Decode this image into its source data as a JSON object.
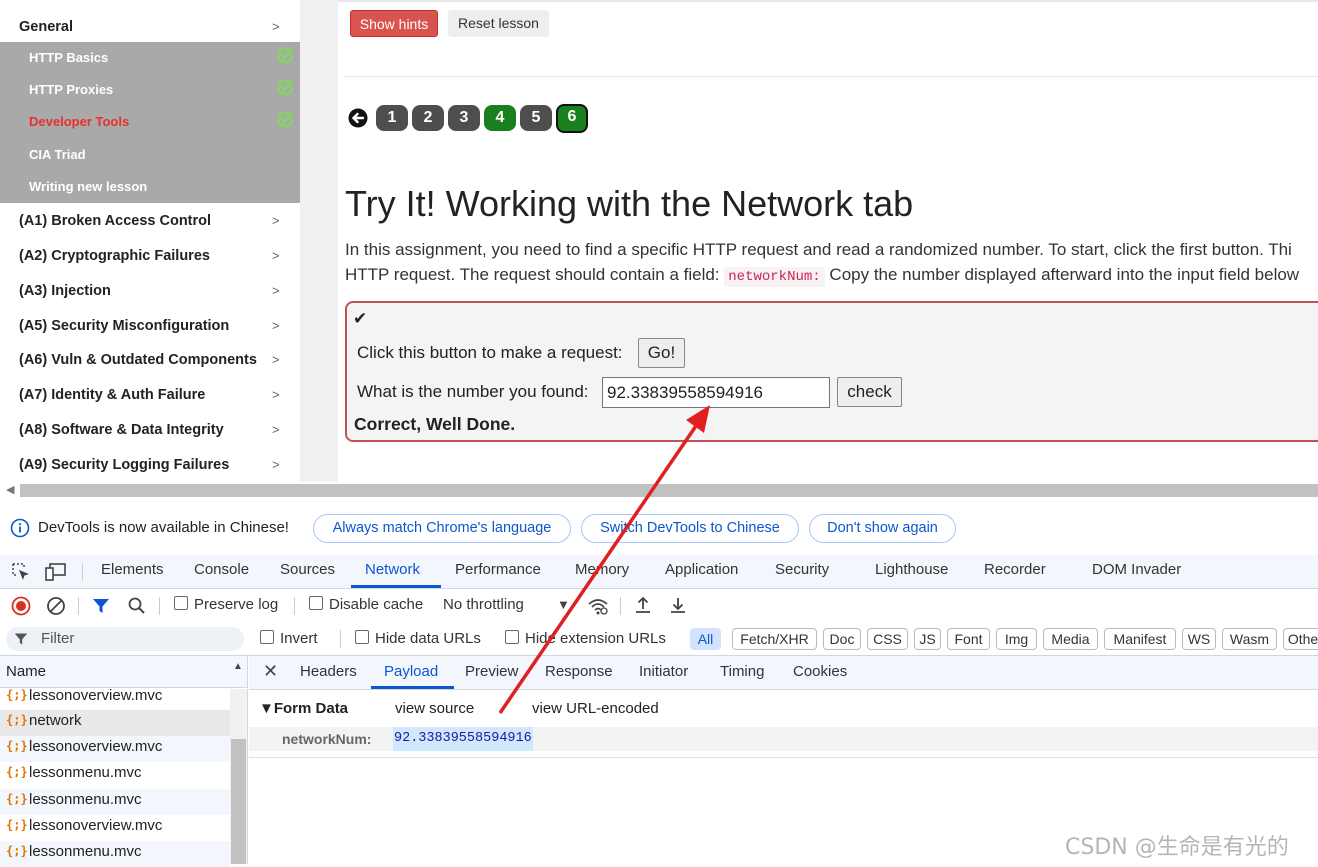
{
  "sidebar": {
    "general": "General",
    "sub_items": [
      {
        "label": "HTTP Basics",
        "completed": true,
        "active": false
      },
      {
        "label": "HTTP Proxies",
        "completed": true,
        "active": false
      },
      {
        "label": "Developer Tools",
        "completed": true,
        "active": true
      },
      {
        "label": "CIA Triad",
        "completed": false,
        "active": false
      },
      {
        "label": "Writing new lesson",
        "completed": false,
        "active": false
      }
    ],
    "categories": [
      "(A1) Broken Access Control",
      "(A2) Cryptographic Failures",
      "(A3) Injection",
      "(A5) Security Misconfiguration",
      "(A6) Vuln & Outdated Components",
      "(A7) Identity & Auth Failure",
      "(A8) Software & Data Integrity",
      "(A9) Security Logging Failures"
    ]
  },
  "lesson": {
    "show_hints": "Show hints",
    "reset_lesson": "Reset lesson",
    "pages": [
      "1",
      "2",
      "3",
      "4",
      "5",
      "6"
    ],
    "title": "Try It! Working with the Network tab",
    "para1": "In this assignment, you need to find a specific HTTP request and read a randomized number. To start, click the first button. Thi",
    "para2_a": "HTTP request. The request should contain a field:",
    "para2_code": "networkNum:",
    "para2_b": "Copy the number displayed afterward into the input field below",
    "check_mark": "✔",
    "request_label": "Click this button to make a request:",
    "go_button": "Go!",
    "number_label": "What is the number you found:",
    "number_value": "92.33839558594916",
    "check_button": "check",
    "feedback": "Correct, Well Done."
  },
  "devtools": {
    "info_text": "DevTools is now available in Chinese!",
    "info_buttons": [
      "Always match Chrome's language",
      "Switch DevTools to Chinese",
      "Don't show again"
    ],
    "tabs": [
      "Elements",
      "Console",
      "Sources",
      "Network",
      "Performance",
      "Memory",
      "Application",
      "Security",
      "Lighthouse",
      "Recorder",
      "DOM Invader"
    ],
    "selected_tab": "Network",
    "preserve_log": "Preserve log",
    "disable_cache": "Disable cache",
    "throttling": "No throttling",
    "filter_placeholder": "Filter",
    "invert": "Invert",
    "hide_data_urls": "Hide data URLs",
    "hide_extension_urls": "Hide extension URLs",
    "type_filters": [
      "All",
      "Fetch/XHR",
      "Doc",
      "CSS",
      "JS",
      "Font",
      "Img",
      "Media",
      "Manifest",
      "WS",
      "Wasm",
      "Othe"
    ],
    "name_header": "Name",
    "requests": [
      "lessonoverview.mvc",
      "network",
      "lessonoverview.mvc",
      "lessonmenu.mvc",
      "lessonmenu.mvc",
      "lessonoverview.mvc",
      "lessonmenu.mvc"
    ],
    "detail_tabs": [
      "Headers",
      "Payload",
      "Preview",
      "Response",
      "Initiator",
      "Timing",
      "Cookies"
    ],
    "selected_detail_tab": "Payload",
    "form_data": "▼Form Data",
    "view_source": "view source",
    "view_url_encoded": "view URL-encoded",
    "payload_key": "networkNum:",
    "payload_value": "92.33839558594916"
  },
  "watermark": "CSDN @生命是有光的",
  "colors": {
    "accent": "#0b57d0",
    "danger": "#d9534f",
    "green": "#19801f",
    "annotation": "#e02020"
  }
}
